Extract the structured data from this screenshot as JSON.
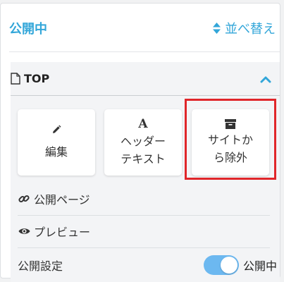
{
  "header": {
    "status_title": "公開中",
    "sort_label": "並べ替え"
  },
  "page": {
    "name": "TOP"
  },
  "actions": {
    "edit_label": "編集",
    "header_text_label_line1": "ヘッダー",
    "header_text_label_line2": "テキスト",
    "header_text_icon_glyph": "A",
    "exclude_label_line1": "サイトか",
    "exclude_label_line2": "ら除外"
  },
  "links": {
    "public_page_label": "公開ページ",
    "preview_label": "プレビュー"
  },
  "settings": {
    "label": "公開設定",
    "toggle_state_label": "公開中",
    "toggle_on": true
  },
  "colors": {
    "accent": "#32a6d9",
    "toggle": "#6cb8f0",
    "highlight": "#e0262a"
  },
  "icons": {
    "sort": "sort-icon",
    "page": "document-icon",
    "collapse": "chevron-up-icon",
    "edit": "pencil-icon",
    "exclude": "archive-icon",
    "public_page": "link-icon",
    "preview": "eye-icon"
  }
}
